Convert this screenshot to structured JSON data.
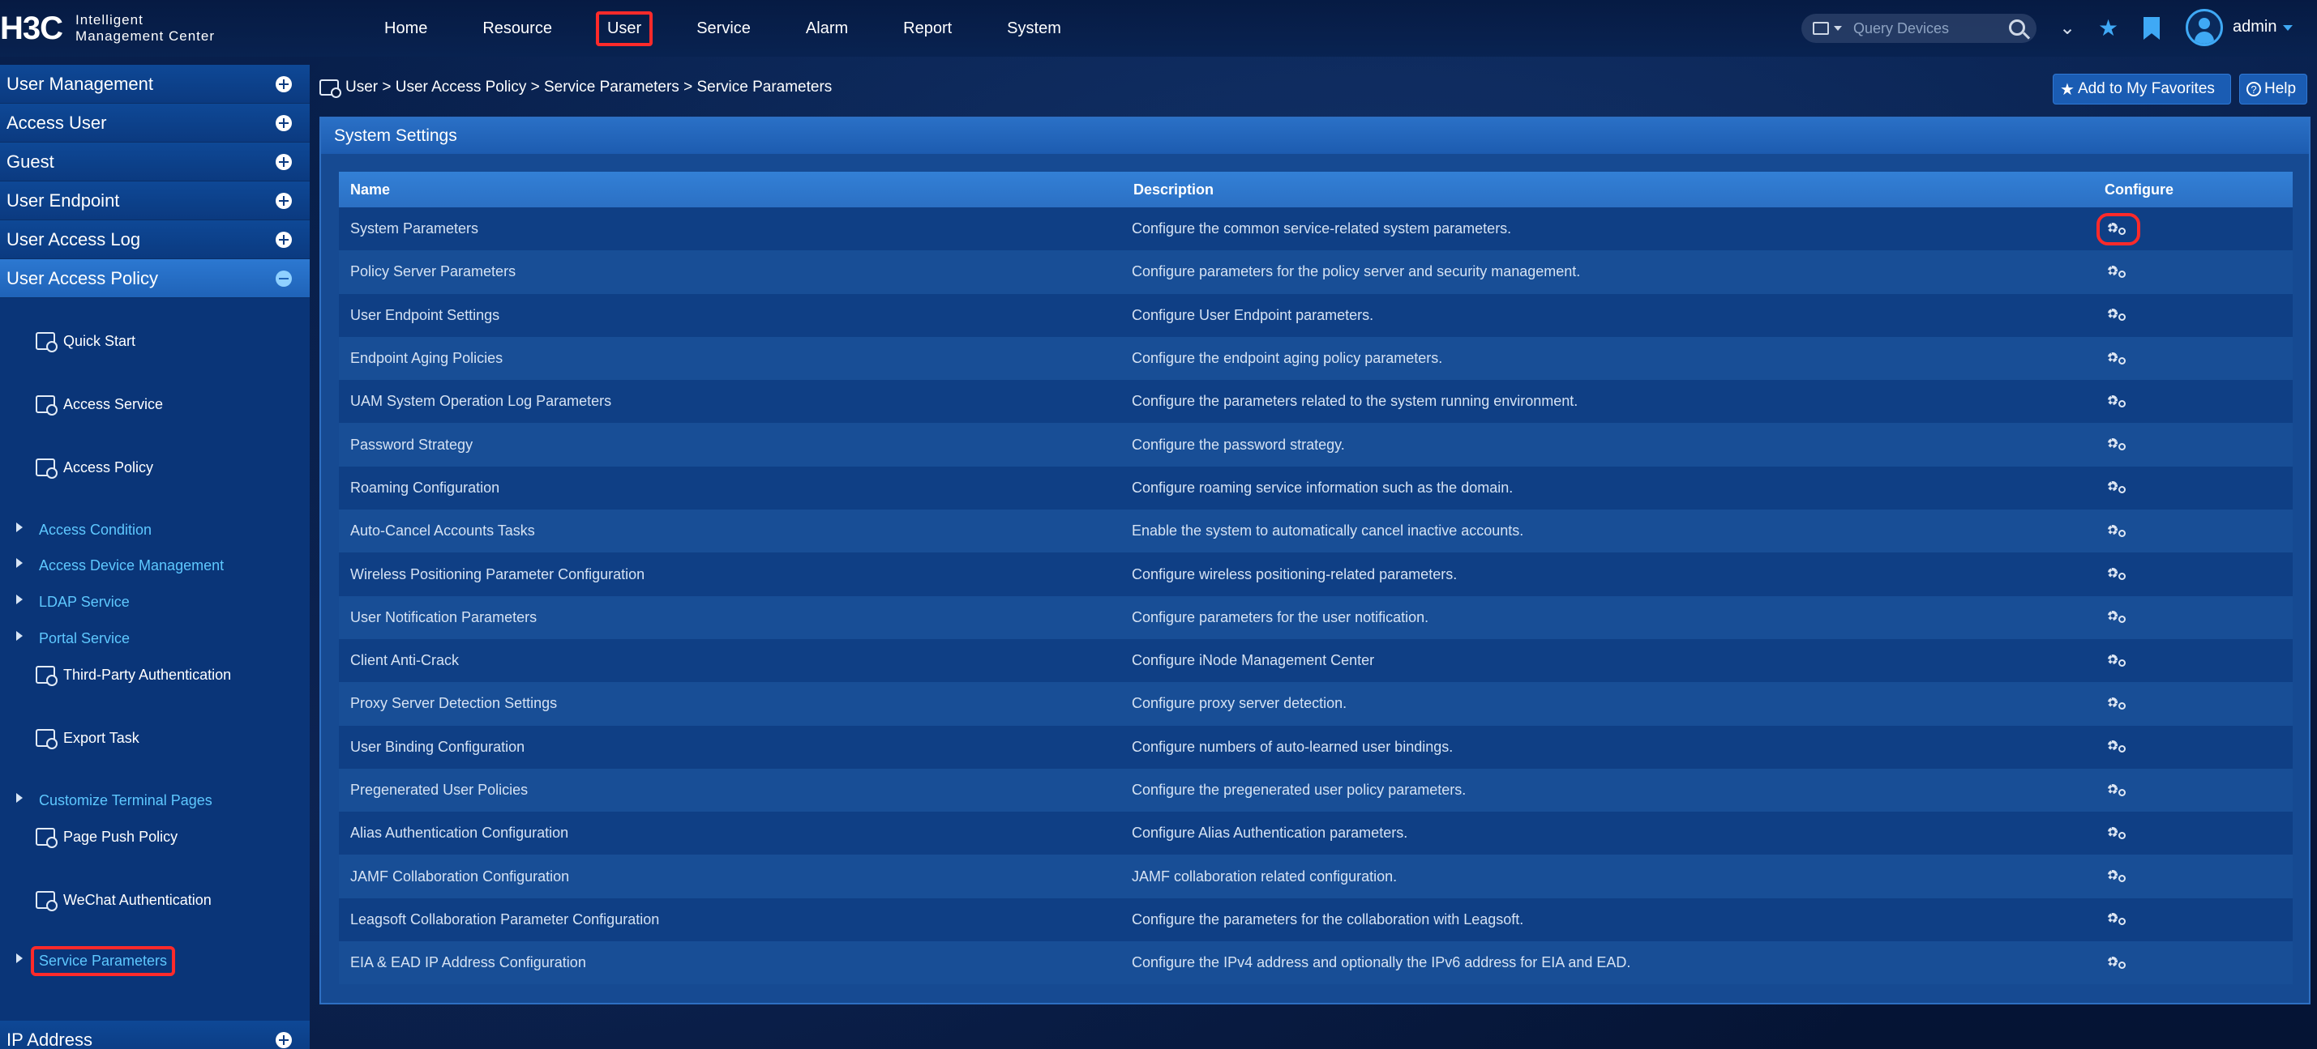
{
  "header": {
    "logo_mark": "H3C",
    "logo_line1": "Intelligent",
    "logo_line2": "Management Center",
    "nav": [
      {
        "label": "Home"
      },
      {
        "label": "Resource"
      },
      {
        "label": "User"
      },
      {
        "label": "Service"
      },
      {
        "label": "Alarm"
      },
      {
        "label": "Report"
      },
      {
        "label": "System"
      }
    ],
    "active_nav": "User",
    "search_placeholder": "Query Devices",
    "user_name": "admin"
  },
  "sidebar": {
    "sections_top": [
      {
        "label": "User Management"
      },
      {
        "label": "Access User"
      },
      {
        "label": "Guest"
      },
      {
        "label": "User Endpoint"
      },
      {
        "label": "User Access Log"
      }
    ],
    "active_section": {
      "label": "User Access Policy"
    },
    "items": [
      {
        "label": "Quick Start",
        "type": "item"
      },
      {
        "label": "Access Service",
        "type": "item"
      },
      {
        "label": "Access Policy",
        "type": "item"
      },
      {
        "label": "Access Condition",
        "type": "group"
      },
      {
        "label": "Access Device Management",
        "type": "group"
      },
      {
        "label": "LDAP Service",
        "type": "group"
      },
      {
        "label": "Portal Service",
        "type": "group"
      },
      {
        "label": "Third-Party Authentication",
        "type": "item"
      },
      {
        "label": "Export Task",
        "type": "item"
      },
      {
        "label": "Customize Terminal Pages",
        "type": "group"
      },
      {
        "label": "Page Push Policy",
        "type": "item"
      },
      {
        "label": "WeChat Authentication",
        "type": "item"
      },
      {
        "label": "Service Parameters",
        "type": "group",
        "selected": true
      }
    ],
    "sections_bottom": [
      {
        "label": "IP Address"
      }
    ]
  },
  "breadcrumb": {
    "path": "User > User Access Policy > Service Parameters > Service Parameters"
  },
  "actions": {
    "favorites_label": "Add to My Favorites",
    "help_label": "Help"
  },
  "panel": {
    "title": "System Settings",
    "columns": {
      "name": "Name",
      "description": "Description",
      "configure": "Configure"
    },
    "rows": [
      {
        "name": "System Parameters",
        "description": "Configure the common service-related system parameters."
      },
      {
        "name": "Policy Server Parameters",
        "description": "Configure parameters for the policy server and security management."
      },
      {
        "name": "User Endpoint Settings",
        "description": "Configure User Endpoint parameters."
      },
      {
        "name": "Endpoint Aging Policies",
        "description": "Configure the endpoint aging policy parameters."
      },
      {
        "name": "UAM System Operation Log Parameters",
        "description": "Configure the parameters related to the system running environment."
      },
      {
        "name": "Password Strategy",
        "description": "Configure the password strategy."
      },
      {
        "name": "Roaming Configuration",
        "description": "Configure roaming service information such as the domain."
      },
      {
        "name": "Auto-Cancel Accounts Tasks",
        "description": "Enable the system to automatically cancel inactive accounts."
      },
      {
        "name": "Wireless Positioning Parameter Configuration",
        "description": "Configure wireless positioning-related parameters."
      },
      {
        "name": "User Notification Parameters",
        "description": "Configure parameters for the user notification."
      },
      {
        "name": "Client Anti-Crack",
        "description": "Configure iNode Management Center"
      },
      {
        "name": "Proxy Server Detection Settings",
        "description": "Configure proxy server detection."
      },
      {
        "name": "User Binding Configuration",
        "description": "Configure numbers of auto-learned user bindings."
      },
      {
        "name": "Pregenerated User Policies",
        "description": "Configure the pregenerated user policy parameters."
      },
      {
        "name": "Alias Authentication Configuration",
        "description": "Configure Alias Authentication parameters."
      },
      {
        "name": "JAMF Collaboration Configuration",
        "description": "JAMF collaboration related configuration."
      },
      {
        "name": "Leagsoft Collaboration Parameter Configuration",
        "description": "Configure the parameters for the collaboration with Leagsoft."
      },
      {
        "name": "EIA & EAD IP Address Configuration",
        "description": "Configure the IPv4 address and optionally the IPv6 address for EIA and EAD."
      }
    ]
  }
}
